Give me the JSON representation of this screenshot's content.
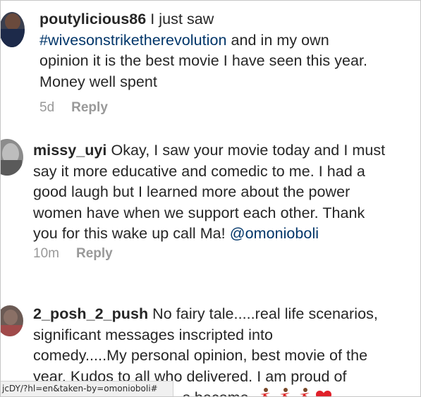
{
  "comments": [
    {
      "username": "poutylicious86",
      "lines": [
        [
          " I just saw"
        ],
        [
          "#wivesonstriketherevolution",
          " and in my own"
        ],
        [
          "opinion it is the best movie I have seen this year."
        ],
        [
          "Money well spent"
        ]
      ],
      "hashtag": "#wivesonstriketherevolution",
      "time": "5d",
      "reply_label": "Reply"
    },
    {
      "username": "missy_uyi",
      "line1": " Okay, I saw your movie today and I must",
      "line2": "say it more educative and comedic to me. I had a",
      "line3": "good laugh but I learned more about the power",
      "line4": "women have when we support each other. Thank",
      "line5": "you for this wake up call Ma! ",
      "mention": "@omonioboli",
      "time": "10m",
      "reply_label": "Reply"
    },
    {
      "username": "2_posh_2_push",
      "line1": " No fairy tale.....real life scenarios,",
      "line2": "significant messages inscripted into",
      "line3": "comedy.....My personal opinion, best movie of the",
      "line4": "year. Kudos to all who delivered.  I am proud of",
      "line5_tail": "s become",
      "emojis": [
        "dancer-emoji",
        "dancer-emoji",
        "dancer-emoji",
        "red-heart-emoji"
      ]
    }
  ],
  "statusbar_url": "jcDY/?hl=en&taken-by=omonioboli#",
  "colors": {
    "text": "#262626",
    "link": "#003569",
    "meta": "#999999"
  }
}
